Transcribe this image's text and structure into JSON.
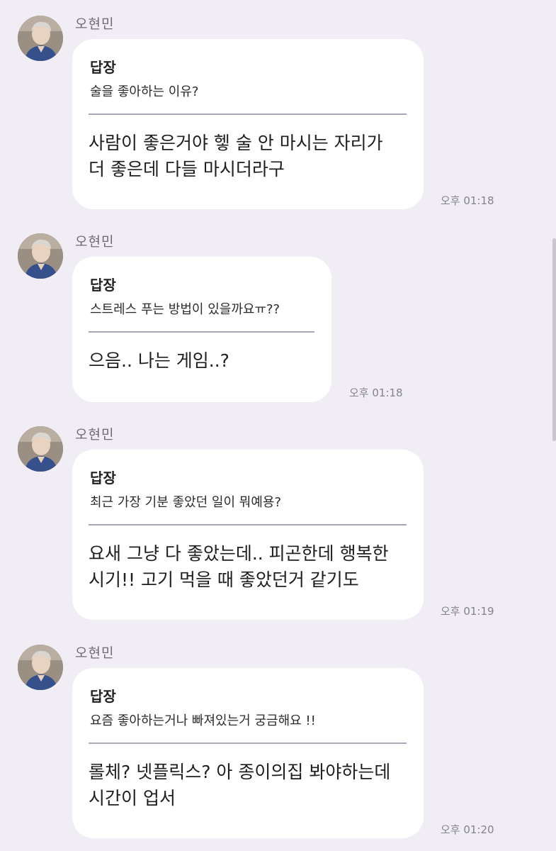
{
  "chat": {
    "messages": [
      {
        "sender": "오현민",
        "reply_label": "답장",
        "quoted_question": "술을 좋아하는 이유?",
        "answer_lines": [
          "사람이 좋은거야 헿 술 안 마시는 자리가",
          "더 좋은데 다들 마시더라구"
        ],
        "time": "오후 01:18"
      },
      {
        "sender": "오현민",
        "reply_label": "답장",
        "quoted_question": "스트레스 푸는 방법이 있을까요ㅠ??",
        "answer_lines": [
          "으음.. 나는 게임..?"
        ],
        "time": "오후 01:18"
      },
      {
        "sender": "오현민",
        "reply_label": "답장",
        "quoted_question": "최근 가장 기분 좋았던 일이 뭐예용?",
        "answer_lines": [
          "요새 그냥 다 좋았는데.. 피곤한데 행복한",
          "시기!! 고기 먹을 때 좋았던거 같기도"
        ],
        "time": "오후 01:19"
      },
      {
        "sender": "오현민",
        "reply_label": "답장",
        "quoted_question": "요즘 좋아하는거나 빠져있는거 궁금해요 !!",
        "answer_lines": [
          "롤체? 넷플릭스? 아 종이의집 봐야하는데",
          "시간이 업서"
        ],
        "time": "오후 01:20"
      }
    ]
  },
  "colors": {
    "background": "#f0eef4",
    "bubble": "#ffffff",
    "divider": "#aca5b5",
    "time_text": "#85828a"
  }
}
